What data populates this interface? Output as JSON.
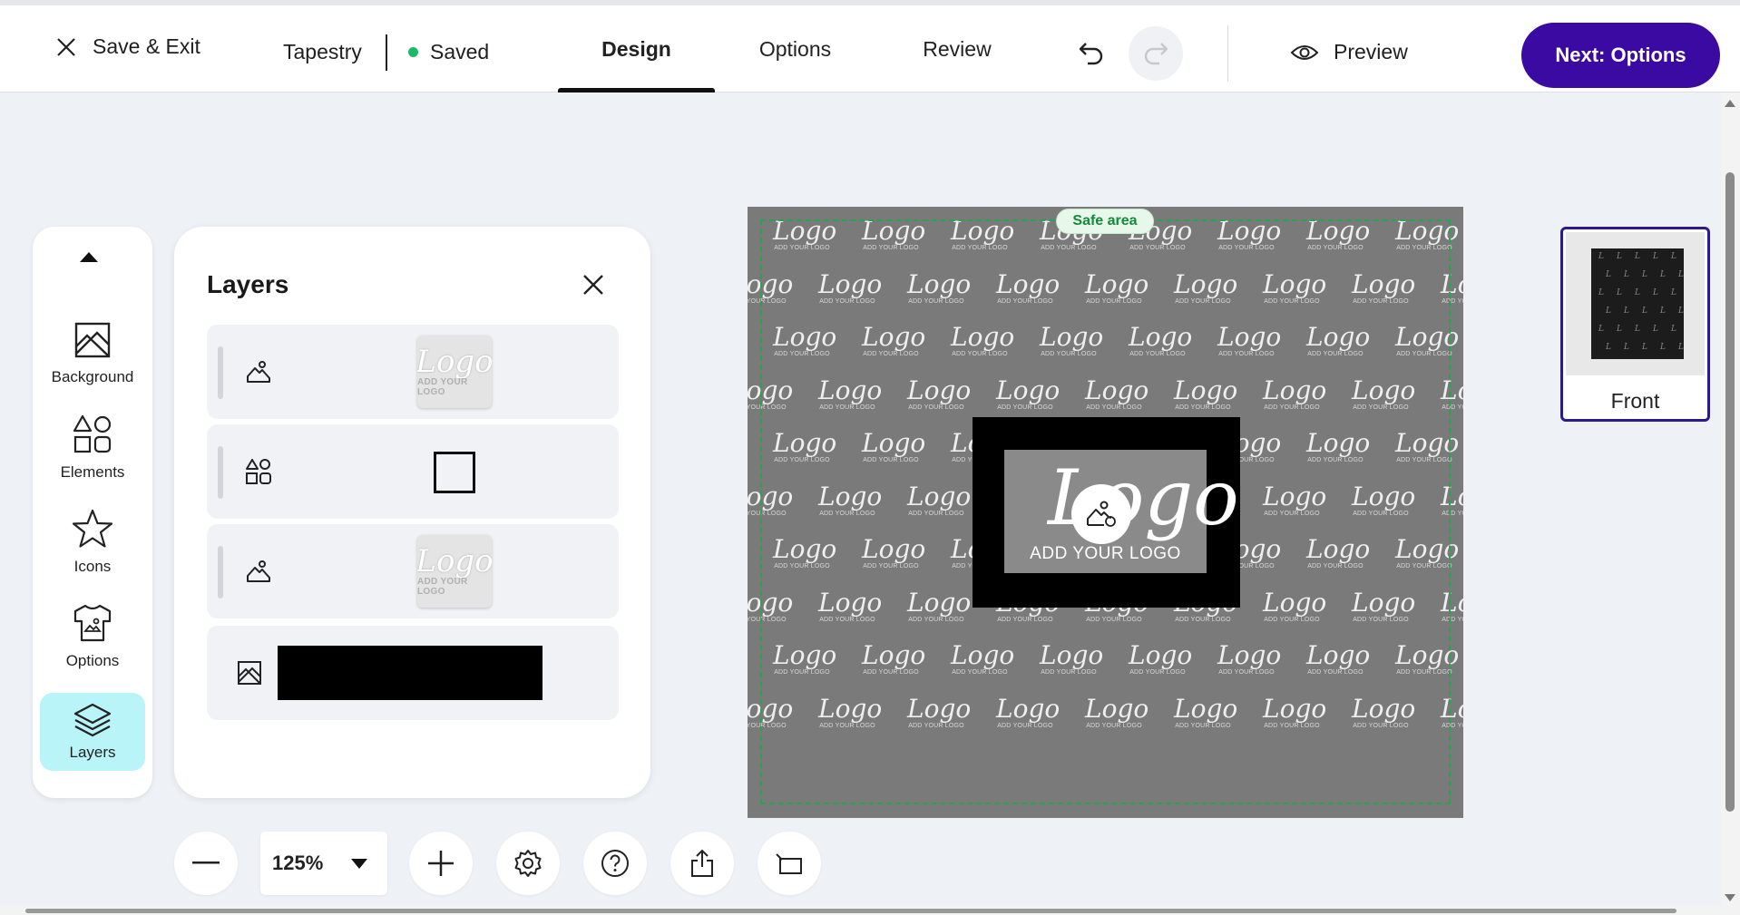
{
  "header": {
    "save_exit_label": "Save & Exit",
    "project_name": "Tapestry",
    "status_text": "Saved",
    "status_color": "#1fb86b",
    "tabs": [
      {
        "label": "Design",
        "active": true
      },
      {
        "label": "Options",
        "active": false
      },
      {
        "label": "Review",
        "active": false
      }
    ],
    "preview_label": "Preview",
    "next_button_label": "Next: Options",
    "accent_color": "#3a0aa3"
  },
  "sidebar": {
    "items": [
      {
        "label": "Background",
        "icon": "image-icon"
      },
      {
        "label": "Elements",
        "icon": "shapes-icon"
      },
      {
        "label": "Icons",
        "icon": "star-icon"
      },
      {
        "label": "Options",
        "icon": "tshirt-icon"
      },
      {
        "label": "Layers",
        "icon": "layers-icon",
        "active": true
      }
    ]
  },
  "layers_panel": {
    "title": "Layers",
    "rows": [
      {
        "type": "image",
        "thumb": "logo",
        "thumb_text": "Logo",
        "thumb_sub": "ADD YOUR LOGO"
      },
      {
        "type": "element",
        "thumb": "square"
      },
      {
        "type": "image",
        "thumb": "logo",
        "thumb_text": "Logo",
        "thumb_sub": "ADD YOUR LOGO"
      },
      {
        "type": "background",
        "thumb": "black-bar"
      }
    ]
  },
  "canvas": {
    "safe_area_label": "Safe area",
    "pattern_word": "Logo",
    "pattern_sub": "ADD YOUR LOGO",
    "center_logo_text": "Logo",
    "center_logo_caption": "ADD YOUR LOGO",
    "background_color": "#7a7a7a"
  },
  "toolbar": {
    "zoom_value": "125%"
  },
  "views": [
    {
      "label": "Front",
      "selected": true
    }
  ]
}
